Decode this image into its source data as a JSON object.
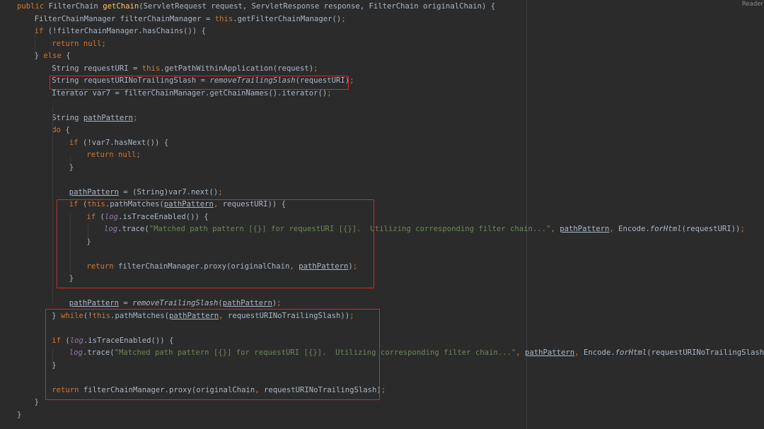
{
  "corner": {
    "reader_mode": "Reader"
  },
  "colors": {
    "keyword": "#cc7832",
    "string": "#6a8759",
    "method_decl": "#ffc66d",
    "field": "#9876aa",
    "default": "#a9b7c6",
    "highlight_box": "#d7262c",
    "background": "#2b2b2b"
  },
  "lines": [
    [
      [
        "kw",
        "public "
      ],
      [
        "",
        "FilterChain "
      ],
      [
        "fn",
        "getChain"
      ],
      [
        "",
        "(ServletRequest request, ServletResponse response, FilterChain originalChain) {"
      ]
    ],
    [
      [
        "",
        "FilterChainManager filterChainManager = "
      ],
      [
        "kw",
        "this"
      ],
      [
        "",
        ".getFilterChainManager()"
      ],
      [
        "kw",
        ";"
      ]
    ],
    [
      [
        "kw",
        "if "
      ],
      [
        "",
        "(!filterChainManager.hasChains()) {"
      ]
    ],
    [
      [
        "kw",
        "return null;"
      ]
    ],
    [
      [
        "",
        "} "
      ],
      [
        "kw",
        "else "
      ],
      [
        "",
        "{"
      ]
    ],
    [
      [
        "",
        "String requestURI = "
      ],
      [
        "kw",
        "this"
      ],
      [
        "",
        ".getPathWithinApplication(request)"
      ],
      [
        "kw",
        ";"
      ]
    ],
    [
      [
        "",
        "String requestURINoTrailingSlash = "
      ],
      [
        "it",
        "removeTrailingSlash"
      ],
      [
        "",
        "(requestURI)"
      ],
      [
        "kw",
        ";"
      ]
    ],
    [
      [
        "",
        "Iterator var7 = filterChainManager.getChainNames().iterator()"
      ],
      [
        "kw",
        ";"
      ]
    ],
    [],
    [
      [
        "",
        "String "
      ],
      [
        "u",
        "pathPattern"
      ],
      [
        "kw",
        ";"
      ]
    ],
    [
      [
        "kw",
        "do "
      ],
      [
        "",
        "{"
      ]
    ],
    [
      [
        "kw",
        "if "
      ],
      [
        "",
        "(!var7.hasNext()) {"
      ]
    ],
    [
      [
        "kw",
        "return null;"
      ]
    ],
    [
      [
        "",
        "}"
      ]
    ],
    [],
    [
      [
        "u",
        "pathPattern"
      ],
      [
        "",
        " = (String)var7.next()"
      ],
      [
        "kw",
        ";"
      ]
    ],
    [
      [
        "kw",
        "if "
      ],
      [
        "",
        "("
      ],
      [
        "kw",
        "this"
      ],
      [
        "",
        ".pathMatches("
      ],
      [
        "u",
        "pathPattern"
      ],
      [
        "kw",
        ", "
      ],
      [
        "",
        "requestURI)) {"
      ]
    ],
    [
      [
        "kw",
        "if "
      ],
      [
        "",
        "("
      ],
      [
        "fld",
        "log"
      ],
      [
        "",
        ".isTraceEnabled()) {"
      ]
    ],
    [
      [
        "fld",
        "log"
      ],
      [
        "",
        ".trace("
      ],
      [
        "str",
        "\"Matched path pattern [{}] for requestURI [{}].  Utilizing corresponding filter chain...\""
      ],
      [
        "kw",
        ", "
      ],
      [
        "u",
        "pathPattern"
      ],
      [
        "kw",
        ", "
      ],
      [
        "",
        "Encode."
      ],
      [
        "it",
        "forHtml"
      ],
      [
        "",
        "(requestURI))"
      ],
      [
        "kw",
        ";"
      ]
    ],
    [
      [
        "",
        "}"
      ]
    ],
    [],
    [
      [
        "kw",
        "return "
      ],
      [
        "",
        "filterChainManager.proxy(originalChain"
      ],
      [
        "kw",
        ", "
      ],
      [
        "u",
        "pathPattern"
      ],
      [
        "",
        ")"
      ],
      [
        "kw",
        ";"
      ]
    ],
    [
      [
        "",
        "}"
      ]
    ],
    [],
    [
      [
        "u",
        "pathPattern"
      ],
      [
        "",
        " = "
      ],
      [
        "it",
        "removeTrailingSlash"
      ],
      [
        "",
        "("
      ],
      [
        "u",
        "pathPattern"
      ],
      [
        "",
        ")"
      ],
      [
        "kw",
        ";"
      ]
    ],
    [
      [
        "",
        "} "
      ],
      [
        "kw",
        "while"
      ],
      [
        "",
        "(!"
      ],
      [
        "kw",
        "this"
      ],
      [
        "",
        ".pathMatches("
      ],
      [
        "u",
        "pathPattern"
      ],
      [
        "kw",
        ", "
      ],
      [
        "",
        "requestURINoTrailingSlash))"
      ],
      [
        "kw",
        ";"
      ]
    ],
    [],
    [
      [
        "kw",
        "if "
      ],
      [
        "",
        "("
      ],
      [
        "fld",
        "log"
      ],
      [
        "",
        ".isTraceEnabled()) {"
      ]
    ],
    [
      [
        "fld",
        "log"
      ],
      [
        "",
        ".trace("
      ],
      [
        "str",
        "\"Matched path pattern [{}] for requestURI [{}].  Utilizing corresponding filter chain...\""
      ],
      [
        "kw",
        ", "
      ],
      [
        "u",
        "pathPattern"
      ],
      [
        "kw",
        ", "
      ],
      [
        "",
        "Encode."
      ],
      [
        "it",
        "forHtml"
      ],
      [
        "",
        "(requestURINoTrailingSlash))"
      ],
      [
        "kw",
        ";"
      ]
    ],
    [
      [
        "",
        "}"
      ]
    ],
    [],
    [
      [
        "kw",
        "return "
      ],
      [
        "",
        "filterChainManager.proxy(originalChain"
      ],
      [
        "kw",
        ", "
      ],
      [
        "",
        "requestURINoTrailingSlash)"
      ],
      [
        "kw",
        ";"
      ]
    ],
    [
      [
        "",
        "}"
      ]
    ],
    [
      [
        "",
        "}"
      ]
    ]
  ]
}
